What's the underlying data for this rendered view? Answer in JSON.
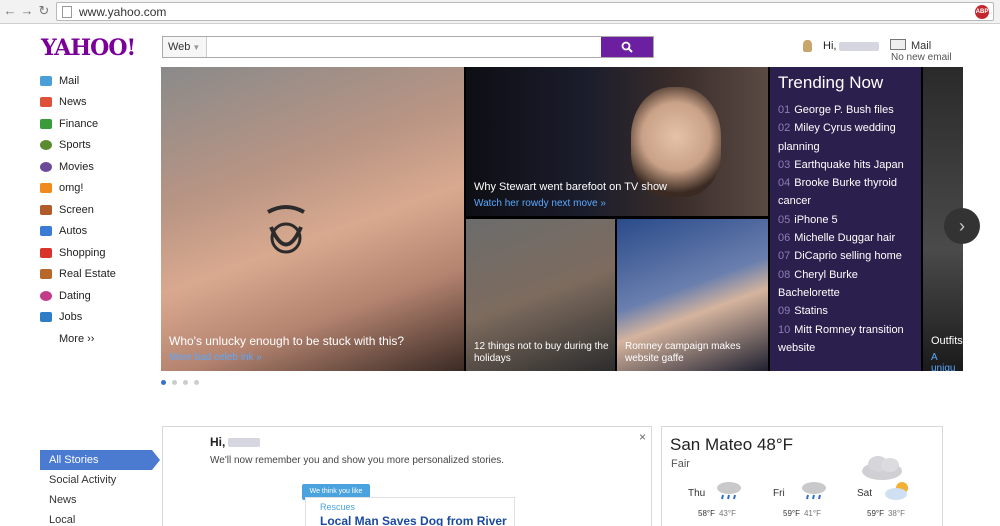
{
  "browser": {
    "url": "www.yahoo.com",
    "back_icon": "back-arrow",
    "forward_icon": "forward-arrow",
    "reload_icon": "reload",
    "adblock_label": "ABP"
  },
  "header": {
    "logo_text": "YAHOO!",
    "logo_color": "#7b0099",
    "search": {
      "scope": "Web",
      "value": "",
      "button_icon": "magnifier",
      "button_color": "#6c1fa0"
    },
    "user": {
      "greeting": "Hi,"
    },
    "mail": {
      "label": "Mail",
      "status": "No new email"
    }
  },
  "left_nav": {
    "items": [
      {
        "label": "Mail",
        "icon": "mail-icon",
        "color": "#4a9fd8"
      },
      {
        "label": "News",
        "icon": "news-icon",
        "color": "#e0513a"
      },
      {
        "label": "Finance",
        "icon": "finance-icon",
        "color": "#3b9b3b"
      },
      {
        "label": "Sports",
        "icon": "sports-icon",
        "color": "#5b8a2f"
      },
      {
        "label": "Movies",
        "icon": "movies-icon",
        "color": "#6b4a9a"
      },
      {
        "label": "omg!",
        "icon": "omg-icon",
        "color": "#f08a1c"
      },
      {
        "label": "Screen",
        "icon": "screen-icon",
        "color": "#b15a2a"
      },
      {
        "label": "Autos",
        "icon": "autos-icon",
        "color": "#3a7bd5"
      },
      {
        "label": "Shopping",
        "icon": "shopping-icon",
        "color": "#d8342c"
      },
      {
        "label": "Real Estate",
        "icon": "real-estate-icon",
        "color": "#b8672b"
      },
      {
        "label": "Dating",
        "icon": "dating-icon",
        "color": "#c23a8a"
      },
      {
        "label": "Jobs",
        "icon": "jobs-icon",
        "color": "#2f7cc7"
      }
    ],
    "more_label": "More ››"
  },
  "hero": {
    "main": {
      "caption": "Who's unlucky enough to be stuck with this?",
      "link": "More bad celeb ink »"
    },
    "top": {
      "caption": "Why Stewart went barefoot on TV show",
      "link": "Watch her rowdy next move »"
    },
    "bottom_left": {
      "caption": "12 things not to buy during the holidays"
    },
    "bottom_right": {
      "caption": "Romney campaign makes website gaffe"
    },
    "edge": {
      "caption": "Outfits",
      "link": "A uniqu"
    },
    "next_icon": "chevron-right",
    "slide_count": 4,
    "active_slide": 1
  },
  "trending": {
    "title": "Trending Now",
    "items": [
      {
        "num": "01",
        "text": "George P. Bush files"
      },
      {
        "num": "02",
        "text": "Miley Cyrus wedding planning"
      },
      {
        "num": "03",
        "text": "Earthquake hits Japan"
      },
      {
        "num": "04",
        "text": "Brooke Burke thyroid cancer"
      },
      {
        "num": "05",
        "text": "iPhone 5"
      },
      {
        "num": "06",
        "text": "Michelle Duggar hair"
      },
      {
        "num": "07",
        "text": "DiCaprio selling home"
      },
      {
        "num": "08",
        "text": "Cheryl Burke Bachelorette"
      },
      {
        "num": "09",
        "text": "Statins"
      },
      {
        "num": "10",
        "text": "Mitt Romney transition website"
      }
    ]
  },
  "stream_nav": {
    "items": [
      "All Stories",
      "Social Activity",
      "News",
      "Local"
    ],
    "active_index": 0,
    "active_color": "#4b7bd0"
  },
  "stories": {
    "greeting": "Hi,",
    "message": "We'll now remember you and show you more personalized stories.",
    "close": "×",
    "tooltip": "We think you like",
    "card_category": "Rescues",
    "card_title": "Local Man Saves Dog from River"
  },
  "weather": {
    "city_temp": "San Mateo 48°F",
    "condition": "Fair",
    "current_icon": "cloud-moon",
    "days": [
      {
        "day": "Thu",
        "icon": "rain",
        "hi": "58°F",
        "lo": "43°F"
      },
      {
        "day": "Fri",
        "icon": "rain",
        "hi": "59°F",
        "lo": "41°F"
      },
      {
        "day": "Sat",
        "icon": "partly-cloudy",
        "hi": "59°F",
        "lo": "38°F"
      }
    ]
  }
}
